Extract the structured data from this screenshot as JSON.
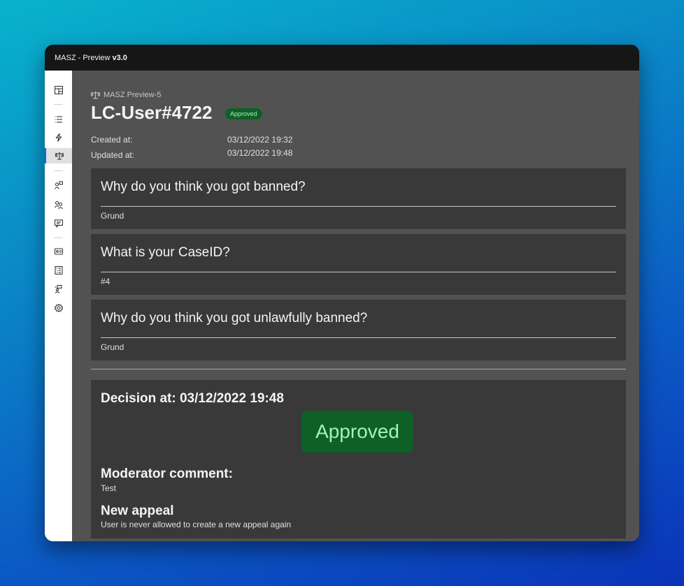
{
  "window": {
    "title_prefix": "MASZ - Preview",
    "title_version": "v3.0"
  },
  "sidebar": {
    "icons": [
      "dashboard-icon",
      "list-icon",
      "bolt-icon",
      "scale-icon",
      "user-badge-icon",
      "users-icon",
      "chat-icon",
      "id-card-icon",
      "checklist-icon",
      "user-settings-icon",
      "gear-icon"
    ],
    "active": "scale-icon"
  },
  "header": {
    "breadcrumb": "MASZ Preview-5",
    "title": "LC-User#4722",
    "status_badge": "Approved"
  },
  "meta": {
    "created_label": "Created at:",
    "created_value": "03/12/2022 19:32",
    "updated_label": "Updated at:",
    "updated_value": "03/12/2022 19:48"
  },
  "questions": [
    {
      "question": "Why do you think you got banned?",
      "answer": "Grund"
    },
    {
      "question": "What is your CaseID?",
      "answer": "#4"
    },
    {
      "question": "Why do you think you got unlawfully banned?",
      "answer": "Grund"
    }
  ],
  "decision": {
    "title": "Decision at: 03/12/2022 19:48",
    "status": "Approved",
    "comment_heading": "Moderator comment:",
    "comment_text": "Test",
    "appeal_heading": "New appeal",
    "appeal_text": "User is never allowed to create a new appeal again"
  },
  "colors": {
    "approved_bg": "#0e6027",
    "approved_text": "#a7f0ba",
    "card_bg": "#393939",
    "main_bg": "#525252"
  }
}
